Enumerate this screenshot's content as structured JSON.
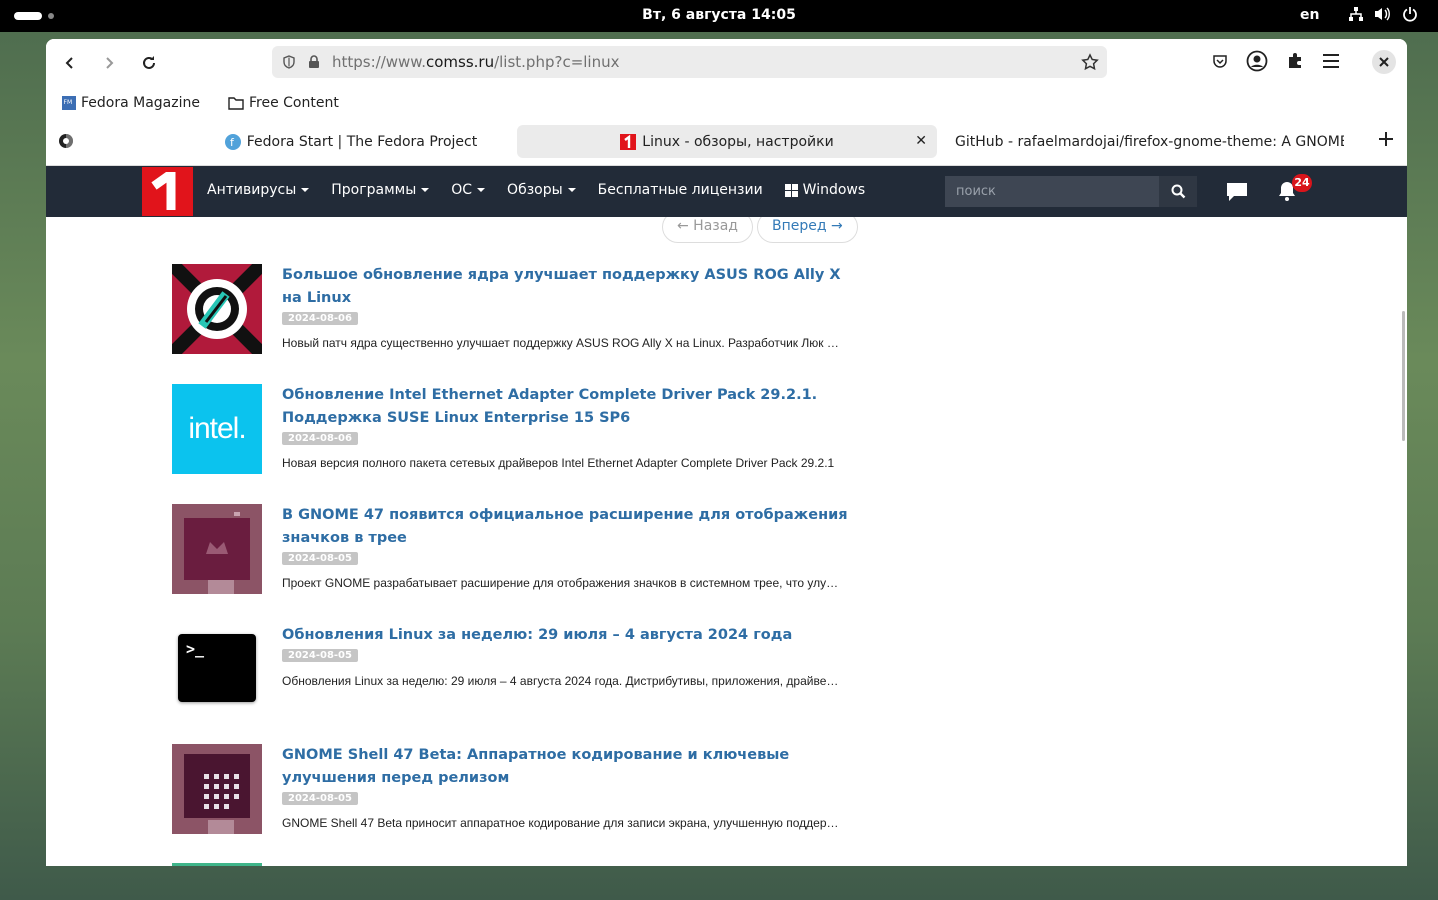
{
  "system": {
    "clock": "Вт, 6 августа  14:05",
    "lang": "en"
  },
  "browser": {
    "url": {
      "scheme": "https://www.",
      "domain": "comss.ru",
      "path": "/list.php?c=linux"
    },
    "bookmarks": [
      "Fedora Magazine",
      "Free Content"
    ],
    "tabs": [
      {
        "label": "Fedora Start | The Fedora Project"
      },
      {
        "label": "Linux - обзоры, настройки",
        "active": true
      },
      {
        "label": "GitHub - rafaelmardojai/firefox-gnome-theme: A GNOME"
      }
    ]
  },
  "site": {
    "logo_text": "1",
    "menu": [
      {
        "label": "Антивирусы",
        "dropdown": true
      },
      {
        "label": "Программы",
        "dropdown": true
      },
      {
        "label": "ОС",
        "dropdown": true
      },
      {
        "label": "Обзоры",
        "dropdown": true
      },
      {
        "label": "Бесплатные лицензии",
        "dropdown": false
      },
      {
        "label": "Windows",
        "dropdown": false
      }
    ],
    "search_placeholder": "поиск",
    "notifications": "24",
    "accent": "#e1141b",
    "link_color": "#2e6da4"
  },
  "pager": {
    "prev": "← Назад",
    "next": "Вперед →"
  },
  "articles": [
    {
      "title": "Большое обновление ядра улучшает поддержку ASUS ROG Ally X на Linux",
      "date": "2024-08-06",
      "desc": "Новый патч ядра существенно улучшает поддержку ASUS ROG Ally X на Linux. Разработчик Люк Джонс",
      "thumb": "asus-rog-logo"
    },
    {
      "title": "Обновление Intel Ethernet Adapter Complete Driver Pack 29.2.1. Поддержка SUSE Linux Enterprise 15 SP6",
      "date": "2024-08-06",
      "desc": "Новая версия полного пакета сетевых драйверов Intel Ethernet Adapter Complete Driver Pack 29.2.1",
      "thumb": "intel-logo",
      "thumb_text": "intel."
    },
    {
      "title": "В GNOME 47 появится официальное расширение для отображения значков в трее",
      "date": "2024-08-05",
      "desc": "Проект GNOME разрабатывает расширение для отображения значков в системном трее, что улучшит",
      "thumb": "gnome-desktop-screenshot"
    },
    {
      "title": "Обновления Linux за неделю: 29 июля – 4 августа 2024 года",
      "date": "2024-08-05",
      "desc": "Обновления Linux за неделю: 29 июля – 4 августа 2024 года. Дистрибутивы, приложения, драйверы и",
      "thumb": "terminal-icon",
      "thumb_text": ">_"
    },
    {
      "title": "GNOME Shell 47 Beta: Аппаратное кодирование и ключевые улучшения перед релизом",
      "date": "2024-08-05",
      "desc": "GNOME Shell 47 Beta приносит аппаратное кодирование для записи экрана, улучшенную поддержку",
      "thumb": "gnome-app-grid-screenshot"
    }
  ]
}
